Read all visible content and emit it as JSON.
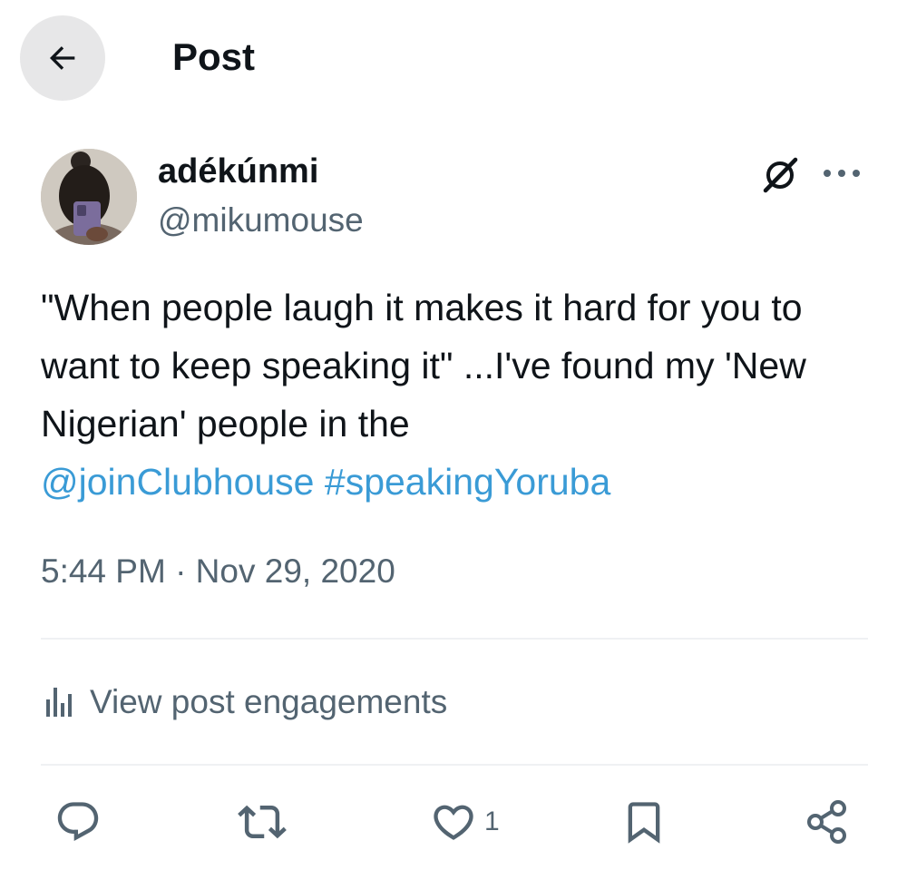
{
  "header": {
    "title": "Post",
    "back_icon": "arrow-left-icon"
  },
  "author": {
    "display_name": "adékúnmi",
    "handle": "@mikumouse"
  },
  "post": {
    "text_plain": "\"When people laugh it makes it hard for you to want to keep speaking it\" ...I've found my 'New Nigerian' people in the ",
    "mention": "@joinClubhouse",
    "hashtag": "#speakingYoruba",
    "timestamp": "5:44 PM · Nov 29, 2020"
  },
  "engagements": {
    "label": "View post engagements",
    "icon": "bar-chart-icon"
  },
  "actions": {
    "reply_icon": "speech-bubble-icon",
    "repost_icon": "repost-icon",
    "like_icon": "heart-icon",
    "like_count": "1",
    "bookmark_icon": "bookmark-icon",
    "share_icon": "share-icon"
  },
  "colors": {
    "link": "#3a9bd6",
    "secondary_text": "#536471",
    "back_button_bg": "#e7e7e8"
  }
}
